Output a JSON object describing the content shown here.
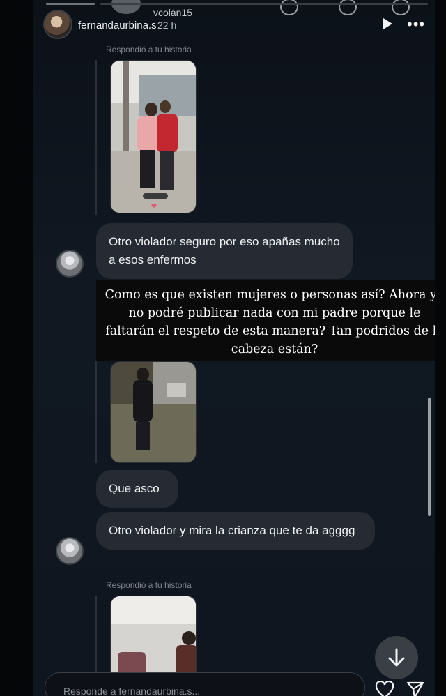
{
  "ghost": {
    "name": "vcolan15"
  },
  "header": {
    "username": "fernandaurbina.s",
    "time": "22 h",
    "more": "•••"
  },
  "replies": [
    {
      "label": "Respondió a tu historia"
    },
    {
      "label": "Respondió a tu historia"
    }
  ],
  "messages": [
    {
      "text": "Otro violador seguro por eso apañas mucho a esos enfermos"
    },
    {
      "text": "Que asco"
    },
    {
      "text": "Otro violador y mira la crianza que te da agggg"
    }
  ],
  "story_caption": "Como es que existen mujeres o personas así? Ahora yo no podré publicar nada con mi padre porque le faltarán el respeto de esta manera? Tan podridos de la cabeza están?",
  "composer": {
    "placeholder": "Responde a fernandaurbina.s..."
  },
  "icons": {
    "play": "play-icon",
    "more": "more-icon",
    "scroll_down": "arrow-down-icon",
    "like": "heart-icon",
    "send": "send-icon"
  },
  "colors": {
    "background": "#111822",
    "bubble": "#262b33",
    "caption_bg": "#0a0a0a"
  }
}
